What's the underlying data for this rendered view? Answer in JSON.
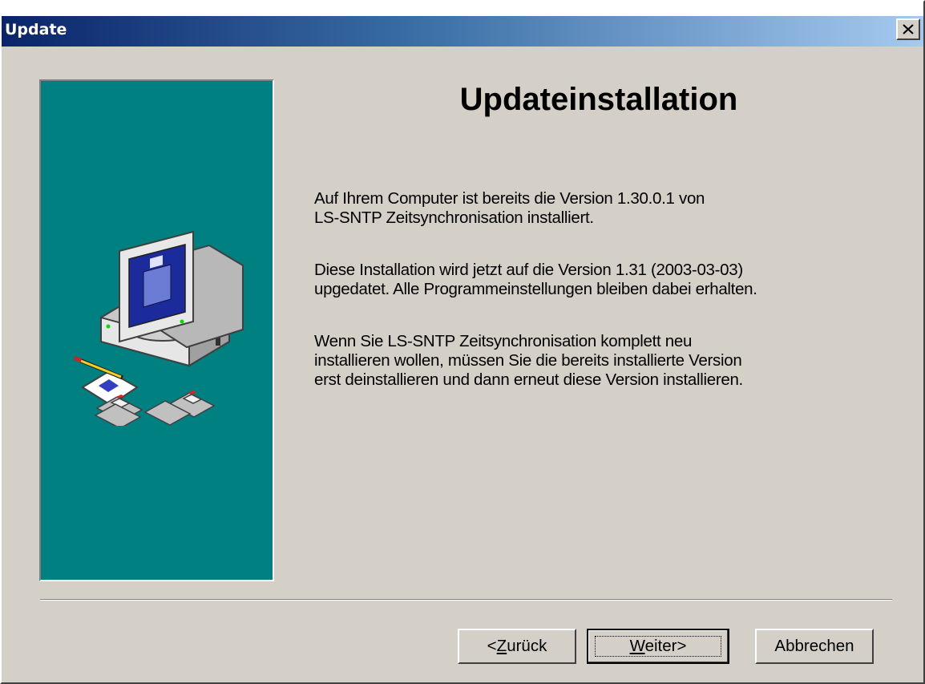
{
  "window": {
    "title": "Update",
    "close_icon": "close-icon"
  },
  "side_panel": {
    "background": "#008080",
    "illustration_icon": "computer-with-disks-icon"
  },
  "main": {
    "heading": "Updateinstallation",
    "paragraphs": [
      [
        "Auf Ihrem Computer ist bereits die Version 1.30.0.1 von",
        "LS-SNTP Zeitsynchronisation installiert."
      ],
      [
        "Diese Installation wird jetzt auf die Version 1.31 (2003-03-03)",
        "upgedatet. Alle Programmeinstellungen bleiben dabei erhalten."
      ],
      [
        "Wenn Sie LS-SNTP Zeitsynchronisation komplett neu",
        "installieren wollen, müssen Sie die bereits installierte Version",
        "erst deinstallieren und dann erneut diese Version installieren."
      ]
    ]
  },
  "buttons": {
    "back": {
      "prefix": "<",
      "mnemonic": "Z",
      "rest": "urück"
    },
    "next": {
      "mnemonic": "W",
      "rest": "eiter>"
    },
    "cancel": "Abbrechen"
  },
  "colors": {
    "titlebar_start": "#0a246a",
    "titlebar_end": "#a6caf0",
    "face": "#d4d0c8"
  }
}
